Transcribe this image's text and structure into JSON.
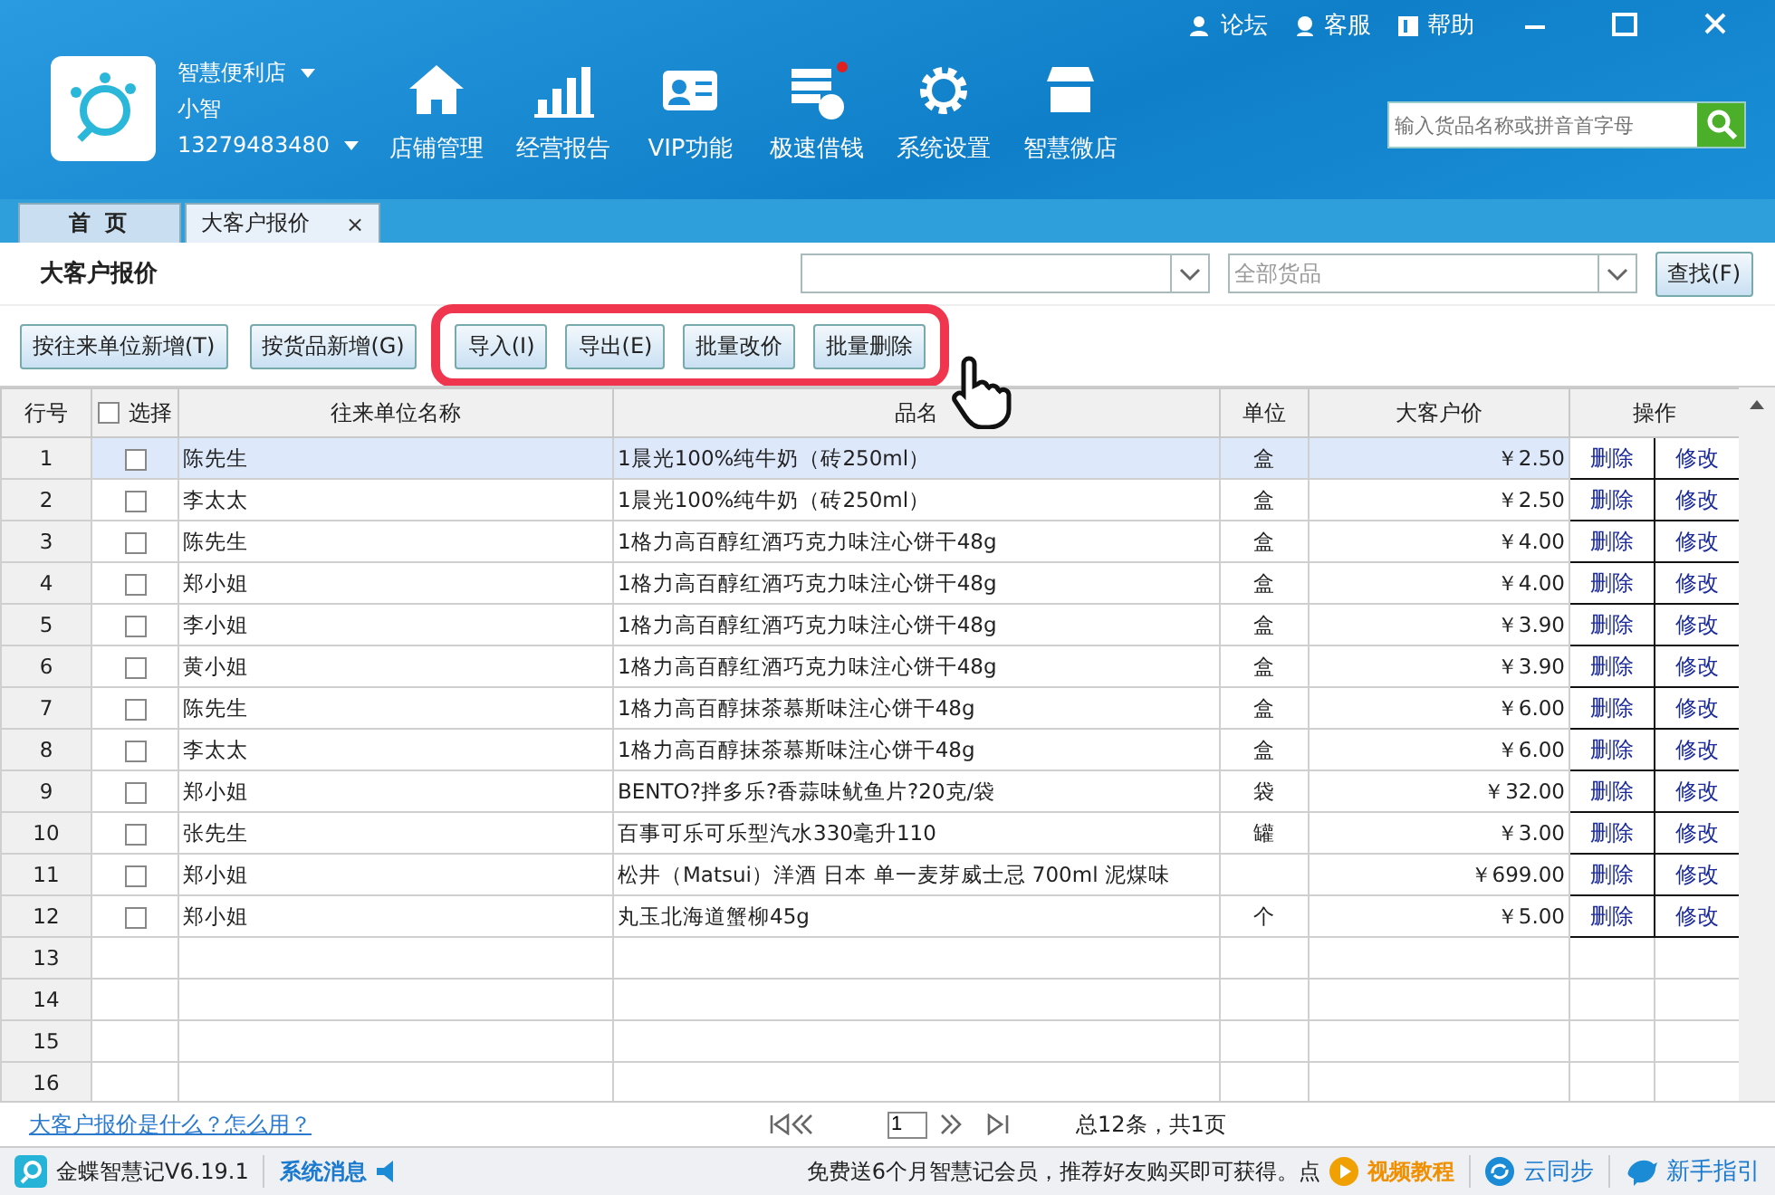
{
  "top_links": [
    "论坛",
    "客服",
    "帮助"
  ],
  "store": {
    "name": "智慧便利店",
    "user": "小智",
    "phone": "13279483480"
  },
  "nav": [
    {
      "label": "店铺管理",
      "badge": false
    },
    {
      "label": "经营报告",
      "badge": false
    },
    {
      "label": "VIP功能",
      "badge": false
    },
    {
      "label": "极速借钱",
      "badge": true
    },
    {
      "label": "系统设置",
      "badge": false
    },
    {
      "label": "智慧微店",
      "badge": false
    }
  ],
  "search": {
    "placeholder": "输入货品名称或拼音首字母"
  },
  "tabs": [
    {
      "label": "首 页",
      "selected": false
    },
    {
      "label": "大客户报价",
      "selected": true,
      "close": "×"
    }
  ],
  "page_title": "大客户报价",
  "filter": {
    "category": "全部货品",
    "button": "查找(F)"
  },
  "actions": [
    "按往来单位新增(T)",
    "按货品新增(G)"
  ],
  "highlight_frame": {
    "actions": [
      "导入(I)",
      "导出(E)",
      "批量改价",
      "批量删除"
    ]
  },
  "table": {
    "select_all_checked": false,
    "columns": [
      "行号",
      "选择",
      "往来单位名称",
      "品名",
      "单位",
      "大客户价",
      "操作"
    ],
    "rows": [
      {
        "kind": "data",
        "no": "1",
        "checked": false,
        "selected": true,
        "customer": "陈先生",
        "product": "1晨光100%纯牛奶（砖250ml）",
        "unit": "盒",
        "price": "￥2.50",
        "delete": "删除",
        "edit": "修改"
      },
      {
        "kind": "data",
        "no": "2",
        "checked": false,
        "selected": false,
        "customer": "李太太",
        "product": "1晨光100%纯牛奶（砖250ml）",
        "unit": "盒",
        "price": "￥2.50",
        "delete": "删除",
        "edit": "修改"
      },
      {
        "kind": "data",
        "no": "3",
        "checked": false,
        "selected": false,
        "customer": "陈先生",
        "product": "1格力高百醇红酒巧克力味注心饼干48g",
        "unit": "盒",
        "price": "￥4.00",
        "delete": "删除",
        "edit": "修改"
      },
      {
        "kind": "data",
        "no": "4",
        "checked": false,
        "selected": false,
        "customer": "郑小姐",
        "product": "1格力高百醇红酒巧克力味注心饼干48g",
        "unit": "盒",
        "price": "￥4.00",
        "delete": "删除",
        "edit": "修改"
      },
      {
        "kind": "data",
        "no": "5",
        "checked": false,
        "selected": false,
        "customer": "李小姐",
        "product": "1格力高百醇红酒巧克力味注心饼干48g",
        "unit": "盒",
        "price": "￥3.90",
        "delete": "删除",
        "edit": "修改"
      },
      {
        "kind": "data",
        "no": "6",
        "checked": false,
        "selected": false,
        "customer": "黄小姐",
        "product": "1格力高百醇红酒巧克力味注心饼干48g",
        "unit": "盒",
        "price": "￥3.90",
        "delete": "删除",
        "edit": "修改"
      },
      {
        "kind": "data",
        "no": "7",
        "checked": false,
        "selected": false,
        "customer": "陈先生",
        "product": "1格力高百醇抹茶慕斯味注心饼干48g",
        "unit": "盒",
        "price": "￥6.00",
        "delete": "删除",
        "edit": "修改"
      },
      {
        "kind": "data",
        "no": "8",
        "checked": false,
        "selected": false,
        "customer": "李太太",
        "product": "1格力高百醇抹茶慕斯味注心饼干48g",
        "unit": "盒",
        "price": "￥6.00",
        "delete": "删除",
        "edit": "修改"
      },
      {
        "kind": "data",
        "no": "9",
        "checked": false,
        "selected": false,
        "customer": "郑小姐",
        "product": "BENTO?拌多乐?香蒜味鱿鱼片?20克/袋",
        "unit": "袋",
        "price": "￥32.00",
        "delete": "删除",
        "edit": "修改"
      },
      {
        "kind": "data",
        "no": "10",
        "checked": false,
        "selected": false,
        "customer": "张先生",
        "product": "百事可乐可乐型汽水330毫升110",
        "unit": "罐",
        "price": "￥3.00",
        "delete": "删除",
        "edit": "修改"
      },
      {
        "kind": "data",
        "no": "11",
        "checked": false,
        "selected": false,
        "customer": "郑小姐",
        "product": "松井（Matsui）洋酒 日本 单一麦芽威士忌 700ml 泥煤味",
        "unit": "",
        "price": "￥699.00",
        "delete": "删除",
        "edit": "修改"
      },
      {
        "kind": "data",
        "no": "12",
        "checked": false,
        "selected": false,
        "customer": "郑小姐",
        "product": "丸玉北海道蟹柳45g",
        "unit": "个",
        "price": "￥5.00",
        "delete": "删除",
        "edit": "修改"
      },
      {
        "kind": "empty",
        "no": "13"
      },
      {
        "kind": "empty",
        "no": "14"
      },
      {
        "kind": "empty",
        "no": "15"
      },
      {
        "kind": "empty",
        "no": "16"
      }
    ]
  },
  "help_link": "大客户报价是什么？怎么用？",
  "pager": {
    "page": "1",
    "summary": "总12条，共1页"
  },
  "status_bar": {
    "version": "金蝶智慧记V6.19.1",
    "messages": "系统消息",
    "promo": "免费送6个月智慧记会员，推荐好友购买即可获得。点",
    "video": "视频教程",
    "sync": "云同步",
    "guide": "新手指引"
  }
}
